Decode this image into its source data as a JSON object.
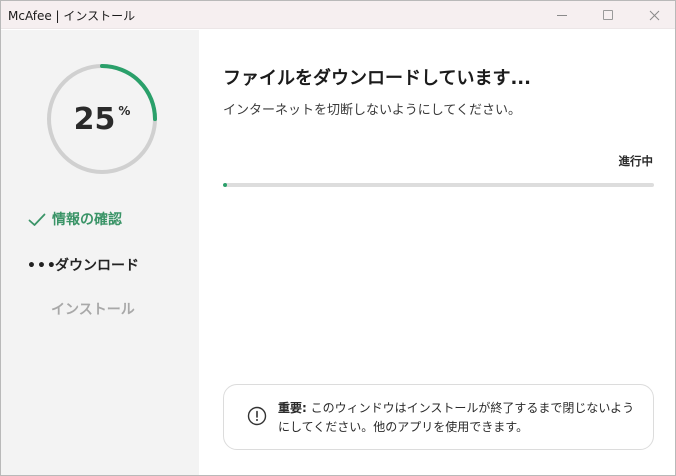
{
  "window": {
    "title": "McAfee | インストール"
  },
  "progress": {
    "percent_number": "25",
    "percent_sign": "%",
    "fraction": 0.25,
    "bar_fraction": 0.01
  },
  "steps": [
    {
      "label": "情報の確認",
      "state": "done"
    },
    {
      "label": "ダウンロード",
      "state": "active",
      "marker": "•••"
    },
    {
      "label": "インストール",
      "state": "pending"
    }
  ],
  "main": {
    "heading": "ファイルをダウンロードしています...",
    "subtext": "インターネットを切断しないようにしてください。",
    "status": "進行中"
  },
  "notice": {
    "label": "重要:",
    "text": " このウィンドウはインストールが終了するまで閉じないようにしてください。他のアプリを使用できます。",
    "icon": "exclamation-circle-icon"
  },
  "colors": {
    "accent": "#2aa06a",
    "done_step": "#3a9467",
    "ring_track": "#d0d0d0",
    "sidebar_bg": "#f3f3f3",
    "titlebar_bg": "#f6eff0"
  }
}
